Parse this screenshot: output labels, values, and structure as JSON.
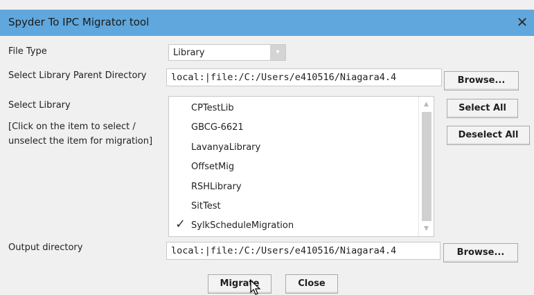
{
  "window": {
    "title": "Spyder To IPC Migrator tool",
    "close_glyph": "✕"
  },
  "file_type": {
    "label": "File Type",
    "selected": "Library",
    "arrow_glyph": "▾"
  },
  "parent_dir": {
    "label": "Select Library Parent Directory",
    "value": "local:|file:/C:/Users/e410516/Niagara4.4",
    "browse_label": "Browse..."
  },
  "library": {
    "label": "Select Library",
    "hint_line1": "[Click on the item to select /",
    "hint_line2": "unselect the item for migration]",
    "select_all_label": "Select All",
    "deselect_all_label": "Deselect All",
    "items": [
      {
        "name": "CPTestLib",
        "checked": false
      },
      {
        "name": "GBCG-6621",
        "checked": false
      },
      {
        "name": "LavanyaLibrary",
        "checked": false
      },
      {
        "name": "OffsetMig",
        "checked": false
      },
      {
        "name": "RSHLibrary",
        "checked": false
      },
      {
        "name": "SitTest",
        "checked": false
      },
      {
        "name": "SylkScheduleMigration",
        "checked": true
      }
    ],
    "check_glyph": "✓",
    "scroll_up_glyph": "▲",
    "scroll_down_glyph": "▼"
  },
  "output_dir": {
    "label": "Output directory",
    "value": "local:|file:/C:/Users/e410516/Niagara4.4",
    "browse_label": "Browse..."
  },
  "footer": {
    "migrate_label": "Migrate",
    "close_label": "Close"
  },
  "colors": {
    "titlebar": "#5fa7dc",
    "window_bg": "#f0f0f0"
  }
}
